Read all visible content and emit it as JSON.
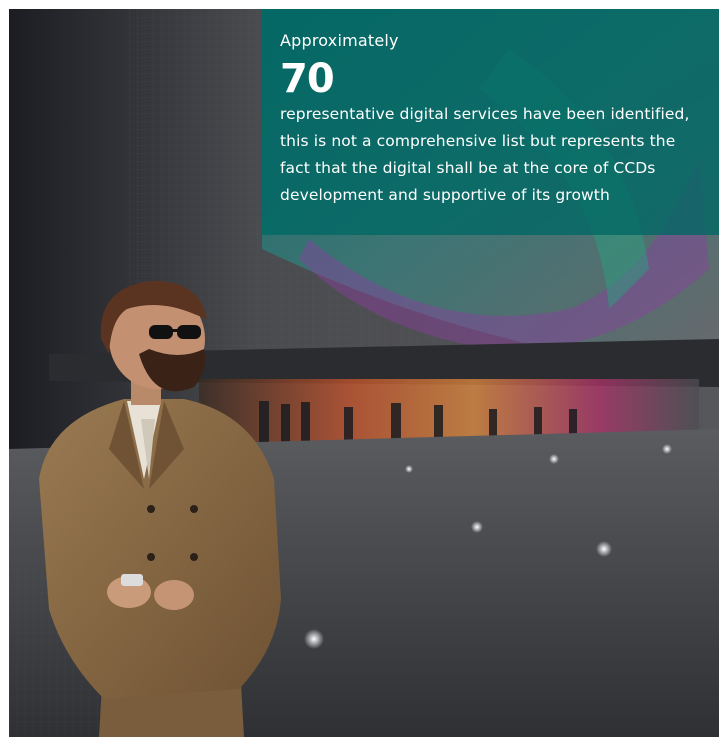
{
  "callout": {
    "lead": "Approximately",
    "number": "70",
    "body": "representative digital services have been identified, this is not a comprehensive list but represents the fact that the digital shall be at the core of CCDs development and supportive of its growth"
  },
  "colors": {
    "callout_bg": "#006864",
    "text": "#ffffff",
    "suit": "#8a6a45"
  },
  "icons": [
    "sparkle-light-icon"
  ]
}
